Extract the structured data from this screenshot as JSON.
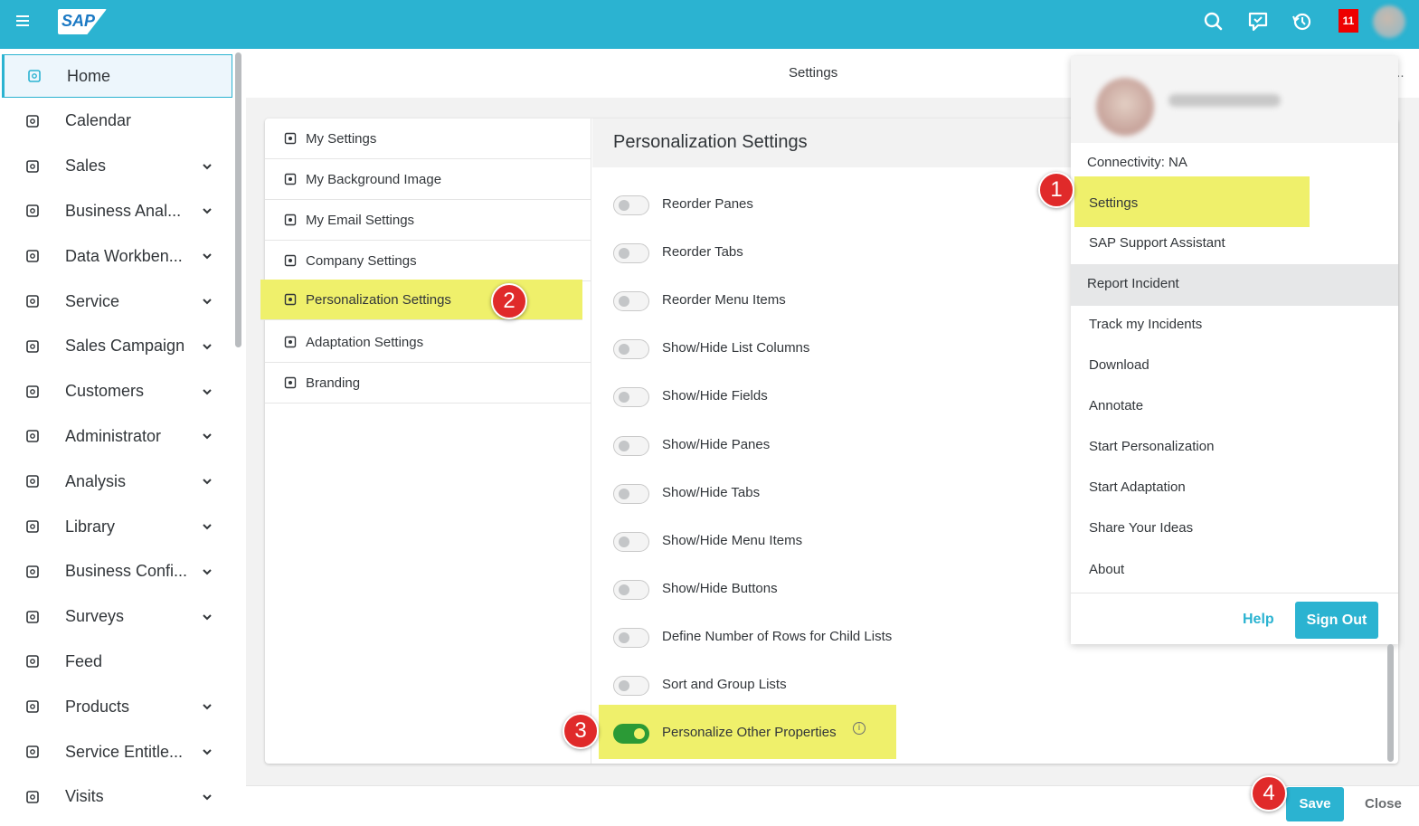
{
  "topbar": {
    "logo": "SAP",
    "notification_count": "11",
    "icons": [
      "menu-icon",
      "search-icon",
      "chat-icon",
      "history-icon",
      "notification-icon",
      "user-avatar"
    ]
  },
  "sidebar": {
    "items": [
      {
        "label": "Home",
        "icon": "home-icon",
        "has_chevron": false,
        "active": true
      },
      {
        "label": "Calendar",
        "icon": "calendar-icon",
        "has_chevron": false
      },
      {
        "label": "Sales",
        "icon": "sales-icon",
        "has_chevron": true
      },
      {
        "label": "Business Anal...",
        "icon": "business-analytics-icon",
        "has_chevron": true
      },
      {
        "label": "Data Workben...",
        "icon": "data-workbench-icon",
        "has_chevron": true
      },
      {
        "label": "Service",
        "icon": "service-icon",
        "has_chevron": true
      },
      {
        "label": "Sales Campaign",
        "icon": "campaign-icon",
        "has_chevron": true
      },
      {
        "label": "Customers",
        "icon": "customers-icon",
        "has_chevron": true
      },
      {
        "label": "Administrator",
        "icon": "administrator-icon",
        "has_chevron": true
      },
      {
        "label": "Analysis",
        "icon": "analysis-icon",
        "has_chevron": true
      },
      {
        "label": "Library",
        "icon": "library-icon",
        "has_chevron": true
      },
      {
        "label": "Business Confi...",
        "icon": "business-config-icon",
        "has_chevron": true
      },
      {
        "label": "Surveys",
        "icon": "surveys-icon",
        "has_chevron": true
      },
      {
        "label": "Feed",
        "icon": "feed-icon",
        "has_chevron": false
      },
      {
        "label": "Products",
        "icon": "products-icon",
        "has_chevron": true
      },
      {
        "label": "Service Entitle...",
        "icon": "service-entitlements-icon",
        "has_chevron": true
      },
      {
        "label": "Visits",
        "icon": "visits-icon",
        "has_chevron": true
      }
    ]
  },
  "settings": {
    "title": "Settings",
    "more": "...",
    "nav": [
      {
        "label": "My Settings",
        "icon": "user-settings-icon"
      },
      {
        "label": "My Background Image",
        "icon": "image-icon"
      },
      {
        "label": "My Email Settings",
        "icon": "email-edit-icon"
      },
      {
        "label": "Company Settings",
        "icon": "company-icon"
      },
      {
        "label": "Personalization Settings",
        "icon": "personalization-icon",
        "selected": true
      },
      {
        "label": "Adaptation Settings",
        "icon": "adaptation-icon"
      },
      {
        "label": "Branding",
        "icon": "branding-icon"
      }
    ],
    "detail_title": "Personalization Settings",
    "toggles": [
      {
        "label": "Reorder Panes",
        "on": false
      },
      {
        "label": "Reorder Tabs",
        "on": false
      },
      {
        "label": "Reorder Menu Items",
        "on": false
      },
      {
        "label": "Show/Hide List Columns",
        "on": false
      },
      {
        "label": "Show/Hide Fields",
        "on": false
      },
      {
        "label": "Show/Hide Panes",
        "on": false
      },
      {
        "label": "Show/Hide Tabs",
        "on": false
      },
      {
        "label": "Show/Hide Menu Items",
        "on": false
      },
      {
        "label": "Show/Hide Buttons",
        "on": false
      },
      {
        "label": "Define Number of Rows for Child Lists",
        "on": false
      },
      {
        "label": "Sort and Group Lists",
        "on": false
      },
      {
        "label": "Personalize Other Properties",
        "on": true
      }
    ],
    "info_glyph": "i"
  },
  "user_menu": {
    "connectivity": "Connectivity: NA",
    "items": [
      {
        "label": "Settings"
      },
      {
        "label": "SAP Support Assistant"
      },
      {
        "label": "Report Incident"
      },
      {
        "label": "Track my Incidents"
      },
      {
        "label": "Download"
      },
      {
        "label": "Annotate"
      },
      {
        "label": "Start Personalization"
      },
      {
        "label": "Start Adaptation"
      },
      {
        "label": "Share Your Ideas"
      },
      {
        "label": "About"
      }
    ],
    "help": "Help",
    "sign_out": "Sign Out"
  },
  "footer": {
    "save": "Save",
    "close": "Close"
  },
  "callouts": [
    "1",
    "2",
    "3",
    "4"
  ],
  "colors": {
    "shell": "#2bb3d1",
    "highlight": "#eff06b",
    "toggle_on": "#2b9a36",
    "badge": "#e02a2a",
    "accent_text": "#2bb3d1"
  }
}
